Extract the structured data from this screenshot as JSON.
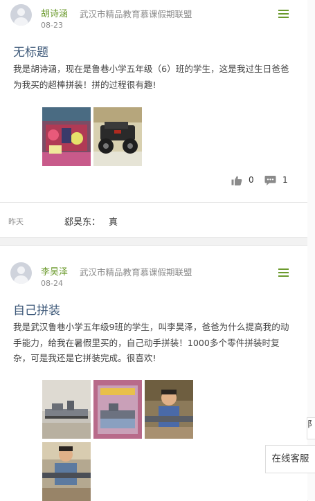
{
  "posts": [
    {
      "username": "胡诗涵",
      "group": "武汉市精品教育慕课假期联盟",
      "date": "08-23",
      "title": "无标题",
      "content": "我是胡诗涵，现在是鲁巷小学五年级（6）班的学生，这是我过生日爸爸为我买的超棒拼装！拼的过程很有趣!",
      "likes": "0",
      "comments": "1"
    },
    {
      "username": "李昊泽",
      "group": "武汉市精品教育慕课假期联盟",
      "date": "08-24",
      "title": "自己拼装",
      "content": "我是武汉鲁巷小学五年级9班的学生，叫李昊泽，爸爸为什么提高我的动手能力，给我在暑假里买的，自己动手拼装！1000多个零件拼装时复杂，可是我还是它拼装完成。很喜欢!"
    }
  ],
  "comment": {
    "time": "昨天",
    "author": "郄昊东：",
    "text": "真"
  },
  "side": {
    "tab_label": "阝",
    "service_label": "在线客服"
  },
  "icons": {
    "menu": "hamburger-menu-icon",
    "like": "thumbs-up-icon",
    "comment": "speech-bubble-icon",
    "avatar": "default-user-avatar"
  },
  "colors": {
    "accent_green": "#6b9a2d",
    "title_blue": "#3f5a7a",
    "muted_gray": "#8a8a8a"
  }
}
